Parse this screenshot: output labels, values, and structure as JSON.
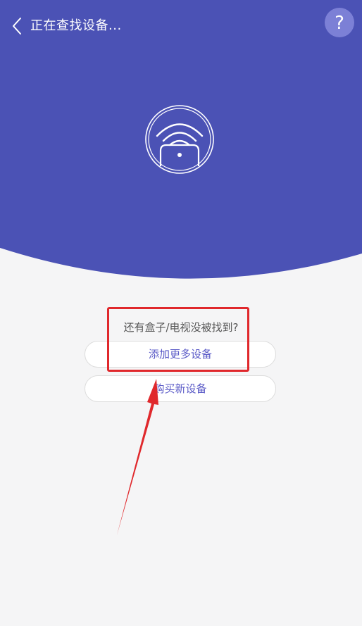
{
  "header": {
    "title": "正在查找设备...",
    "back_icon": "chevron-left-icon",
    "help_icon": "question-icon",
    "help_glyph": "?"
  },
  "device_status": {
    "icon": "wifi-device-icon"
  },
  "prompt": {
    "text": "还有盒子/电视没被找到?"
  },
  "buttons": {
    "add_more": "添加更多设备",
    "buy_new": "购买新设备"
  },
  "colors": {
    "header_bg": "#4b52b5",
    "page_bg": "#f5f5f6",
    "accent": "#5a5ac7",
    "annotation": "#e0282c"
  }
}
